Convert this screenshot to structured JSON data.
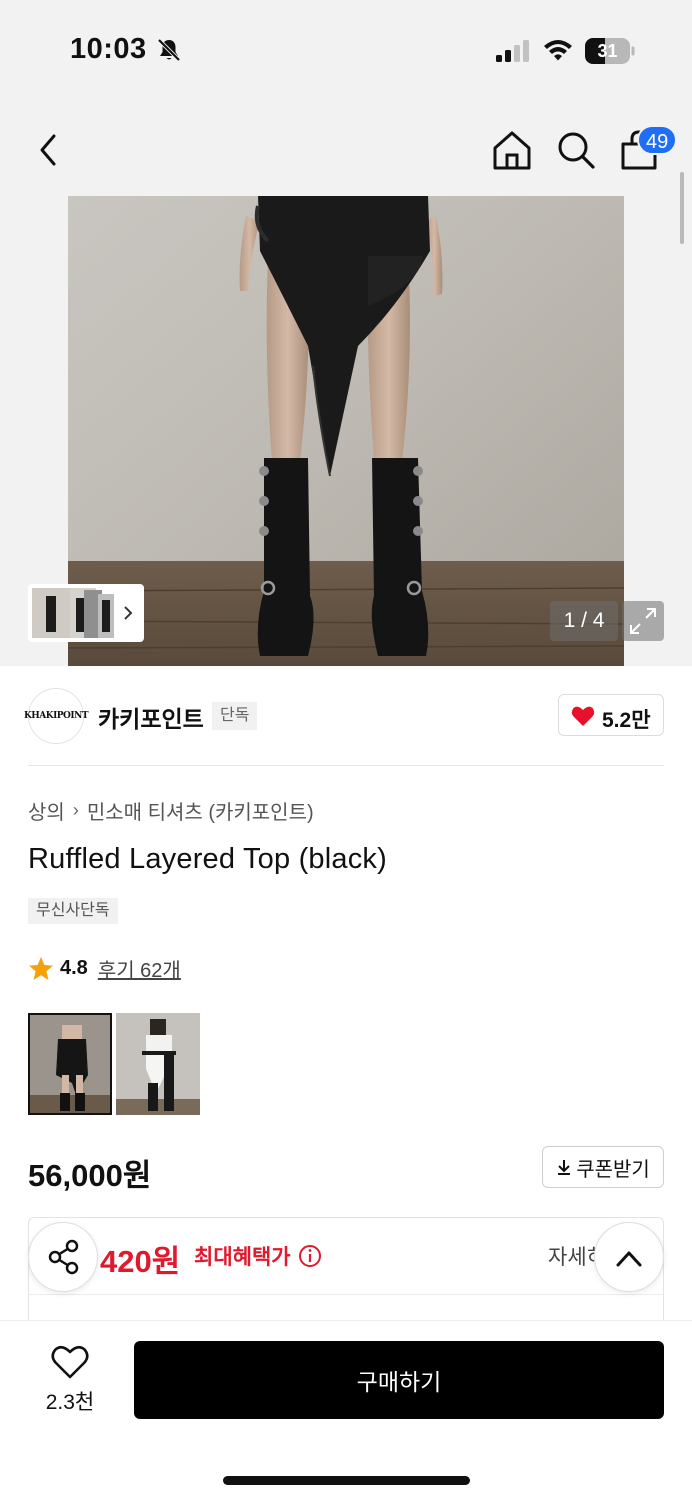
{
  "status_bar": {
    "time": "10:03",
    "battery": "31",
    "icons": [
      "bell-slash-icon",
      "signal-icon",
      "wifi-icon",
      "battery-icon"
    ]
  },
  "nav": {
    "icons": [
      "back-arrow-icon",
      "home-icon",
      "search-icon",
      "shopping-bag-icon"
    ],
    "cart_count": "49"
  },
  "gallery": {
    "indicator": "1 / 4",
    "current": 1,
    "total": 4
  },
  "brand": {
    "logo_text": "KHAKIPOINT",
    "name": "카키포인트",
    "tag": "단독",
    "likes": "5.2만"
  },
  "product": {
    "breadcrumb": [
      "상의",
      "민소매 티셔츠 (카키포인트)"
    ],
    "title": "Ruffled Layered Top (black)",
    "exclusive_tag": "무신사단독",
    "rating": "4.8",
    "reviews": "후기 62개",
    "price": "56,000원",
    "coupon_label": "쿠폰받기",
    "color_options_count": 2,
    "selected_color_option": 1
  },
  "benefit": {
    "price": "420원",
    "label": "최대혜택가",
    "detail_link": "자세히"
  },
  "bottom_bar": {
    "wish_count": "2.3천",
    "buy_label": "구매하기"
  },
  "colors": {
    "accent_blue": "#1e6ff5",
    "price_red": "#e1192d",
    "heart_red": "#e8102a",
    "star_orange": "#f5a20a",
    "buy_button": "#000000"
  }
}
